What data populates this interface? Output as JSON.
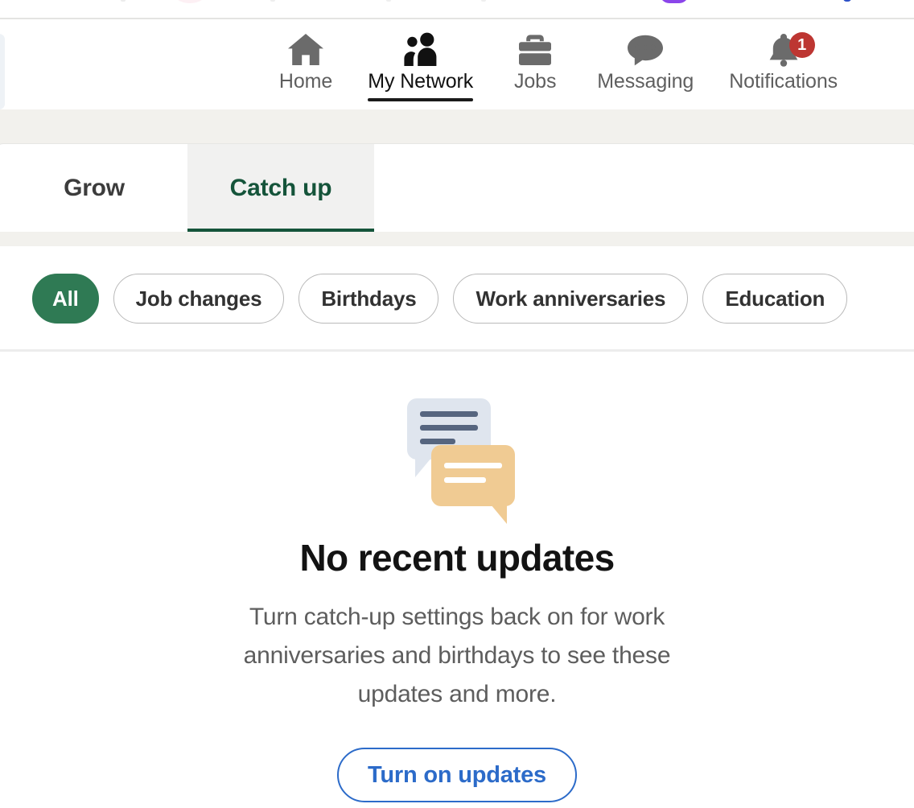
{
  "top_strip": {
    "note": "partially cut-off row above the navigation bar"
  },
  "navbar": {
    "items": [
      {
        "label": "Home",
        "icon": "home-icon",
        "active": false,
        "badge": null
      },
      {
        "label": "My Network",
        "icon": "people-icon",
        "active": true,
        "badge": null
      },
      {
        "label": "Jobs",
        "icon": "briefcase-icon",
        "active": false,
        "badge": null
      },
      {
        "label": "Messaging",
        "icon": "message-bubble-icon",
        "active": false,
        "badge": null
      },
      {
        "label": "Notifications",
        "icon": "bell-icon",
        "active": false,
        "badge": "1"
      }
    ],
    "badge_color": "#bd3632",
    "active_color": "#111111",
    "inactive_color": "#5f5f5f"
  },
  "tabs": {
    "items": [
      {
        "label": "Grow",
        "active": false
      },
      {
        "label": "Catch up",
        "active": true
      }
    ],
    "active_color": "#15543a"
  },
  "filters": {
    "pills": [
      {
        "label": "All",
        "selected": true
      },
      {
        "label": "Job changes",
        "selected": false
      },
      {
        "label": "Birthdays",
        "selected": false
      },
      {
        "label": "Work anniversaries",
        "selected": false
      },
      {
        "label": "Education",
        "selected": false
      }
    ],
    "selected_color": "#2f7a54"
  },
  "empty_state": {
    "illustration": "two-speech-bubbles-illustration",
    "illustration_colors": {
      "bubble_back": "#dfe5ee",
      "bubble_back_lines": "#56657f",
      "bubble_front": "#f0cb93",
      "bubble_front_lines": "#ffffff"
    },
    "title": "No recent updates",
    "body": "Turn catch-up settings back on for work anniversaries and birthdays to see these updates and more.",
    "cta_label": "Turn on updates",
    "cta_color": "#2c6bc9"
  }
}
